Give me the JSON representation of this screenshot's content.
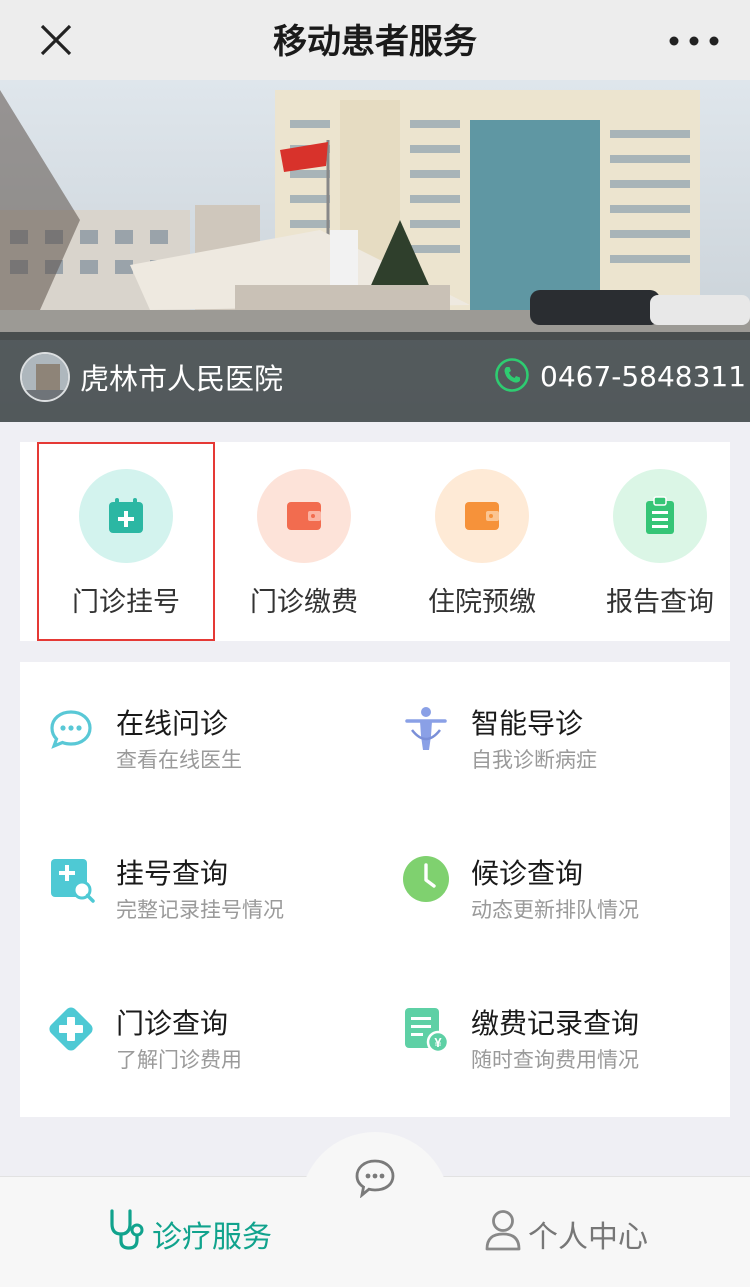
{
  "header": {
    "title": "移动患者服务"
  },
  "banner": {
    "hospital_name": "虎林市人民医院",
    "phone": "0467-5848311"
  },
  "quick_actions": [
    {
      "label": "门诊挂号",
      "icon": "calendar-plus-icon",
      "bg": "#d3f3ee",
      "color": "#2bb7a3"
    },
    {
      "label": "门诊缴费",
      "icon": "wallet-icon",
      "bg": "#fde3d9",
      "color": "#f26c4f"
    },
    {
      "label": "住院预缴",
      "icon": "wallet-icon",
      "bg": "#feead6",
      "color": "#f6923a"
    },
    {
      "label": "报告查询",
      "icon": "clipboard-icon",
      "bg": "#dbf6e6",
      "color": "#35c576"
    }
  ],
  "services": [
    {
      "title": "在线问诊",
      "subtitle": "查看在线医生",
      "icon": "chat-bubble-icon"
    },
    {
      "title": "智能导诊",
      "subtitle": "自我诊断病症",
      "icon": "body-guide-icon"
    },
    {
      "title": "挂号查询",
      "subtitle": "完整记录挂号情况",
      "icon": "register-search-icon"
    },
    {
      "title": "候诊查询",
      "subtitle": "动态更新排队情况",
      "icon": "clock-icon"
    },
    {
      "title": "门诊查询",
      "subtitle": "了解门诊费用",
      "icon": "medical-cross-icon"
    },
    {
      "title": "缴费记录查询",
      "subtitle": "随时查询费用情况",
      "icon": "bill-record-icon"
    }
  ],
  "tabbar": {
    "diagnosis_label": "诊疗服务",
    "me_label": "个人中心"
  },
  "colors": {
    "accent": "#11a38d",
    "selected_outline": "#e53935"
  }
}
